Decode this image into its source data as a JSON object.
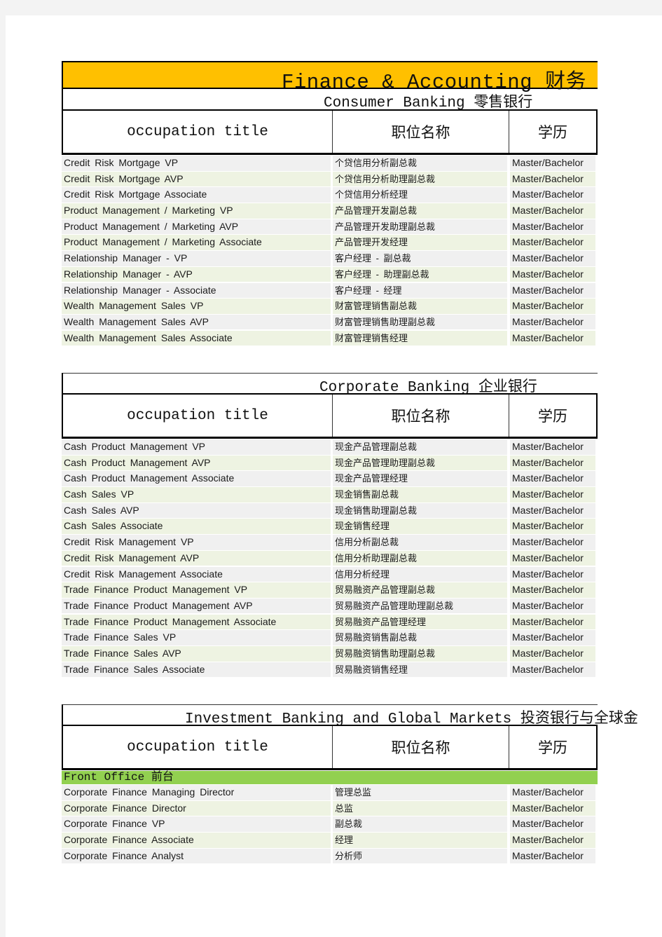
{
  "document": {
    "main_title": "Finance & Accounting 财务",
    "column_headers": {
      "occupation_title": "occupation title",
      "position_name": "职位名称",
      "education": "学历"
    },
    "sections": [
      {
        "title": "Consumer Banking 零售银行",
        "rows": [
          [
            "Credit Risk Mortgage VP",
            "个贷信用分析副总裁",
            "Master/Bachelor"
          ],
          [
            "Credit Risk Mortgage AVP",
            "个贷信用分析助理副总裁",
            "Master/Bachelor"
          ],
          [
            "Credit Risk Mortgage Associate",
            "个贷信用分析经理",
            "Master/Bachelor"
          ],
          [
            "Product Management / Marketing VP",
            "产品管理开发副总裁",
            "Master/Bachelor"
          ],
          [
            "Product Management / Marketing AVP",
            "产品管理开发助理副总裁",
            "Master/Bachelor"
          ],
          [
            "Product Management / Marketing Associate",
            "产品管理开发经理",
            "Master/Bachelor"
          ],
          [
            "Relationship Manager - VP",
            "客户经理 - 副总裁",
            "Master/Bachelor"
          ],
          [
            "Relationship Manager - AVP",
            "客户经理 - 助理副总裁",
            "Master/Bachelor"
          ],
          [
            "Relationship Manager - Associate",
            "客户经理 - 经理",
            "Master/Bachelor"
          ],
          [
            "Wealth Management Sales VP",
            "财富管理销售副总裁",
            "Master/Bachelor"
          ],
          [
            "Wealth Management Sales AVP",
            "财富管理销售助理副总裁",
            "Master/Bachelor"
          ],
          [
            "Wealth Management Sales Associate",
            "财富管理销售经理",
            "Master/Bachelor"
          ]
        ]
      },
      {
        "title": "Corporate Banking 企业银行",
        "rows": [
          [
            "Cash Product Management VP",
            "现金产品管理副总裁",
            "Master/Bachelor"
          ],
          [
            "Cash Product Management AVP",
            "现金产品管理助理副总裁",
            "Master/Bachelor"
          ],
          [
            "Cash Product Management Associate",
            "现金产品管理经理",
            "Master/Bachelor"
          ],
          [
            "Cash Sales VP",
            "现金销售副总裁",
            "Master/Bachelor"
          ],
          [
            "Cash Sales AVP",
            "现金销售助理副总裁",
            "Master/Bachelor"
          ],
          [
            "Cash Sales Associate",
            "现金销售经理",
            "Master/Bachelor"
          ],
          [
            "Credit Risk Management VP",
            "信用分析副总裁",
            "Master/Bachelor"
          ],
          [
            "Credit Risk Management AVP",
            "信用分析助理副总裁",
            "Master/Bachelor"
          ],
          [
            "Credit Risk Management Associate",
            "信用分析经理",
            "Master/Bachelor"
          ],
          [
            "Trade Finance Product Management VP",
            "贸易融资产品管理副总裁",
            "Master/Bachelor"
          ],
          [
            "Trade Finance Product Management AVP",
            "贸易融资产品管理助理副总裁",
            "Master/Bachelor"
          ],
          [
            "Trade Finance Product Management Associate",
            "贸易融资产品管理经理",
            "Master/Bachelor"
          ],
          [
            "Trade Finance Sales VP",
            "贸易融资销售副总裁",
            "Master/Bachelor"
          ],
          [
            "Trade Finance Sales AVP",
            "贸易融资销售助理副总裁",
            "Master/Bachelor"
          ],
          [
            "Trade Finance Sales Associate",
            "贸易融资销售经理",
            "Master/Bachelor"
          ]
        ]
      },
      {
        "title": "Investment Banking and Global Markets 投资银行与全球金",
        "group_label": "Front Office 前台",
        "rows": [
          [
            "Corporate Finance Managing Director",
            "管理总监",
            "Master/Bachelor"
          ],
          [
            "Corporate Finance Director",
            "总监",
            "Master/Bachelor"
          ],
          [
            "Corporate Finance VP",
            "副总裁",
            "Master/Bachelor"
          ],
          [
            "Corporate Finance Associate",
            "经理",
            "Master/Bachelor"
          ],
          [
            "Corporate Finance Analyst",
            "分析师",
            "Master/Bachelor"
          ]
        ]
      }
    ]
  },
  "colors": {
    "title_bar": "#ffc000",
    "group_row": "#92d050",
    "row_odd": "#f0f0f0",
    "row_even": "#eef3e2"
  }
}
